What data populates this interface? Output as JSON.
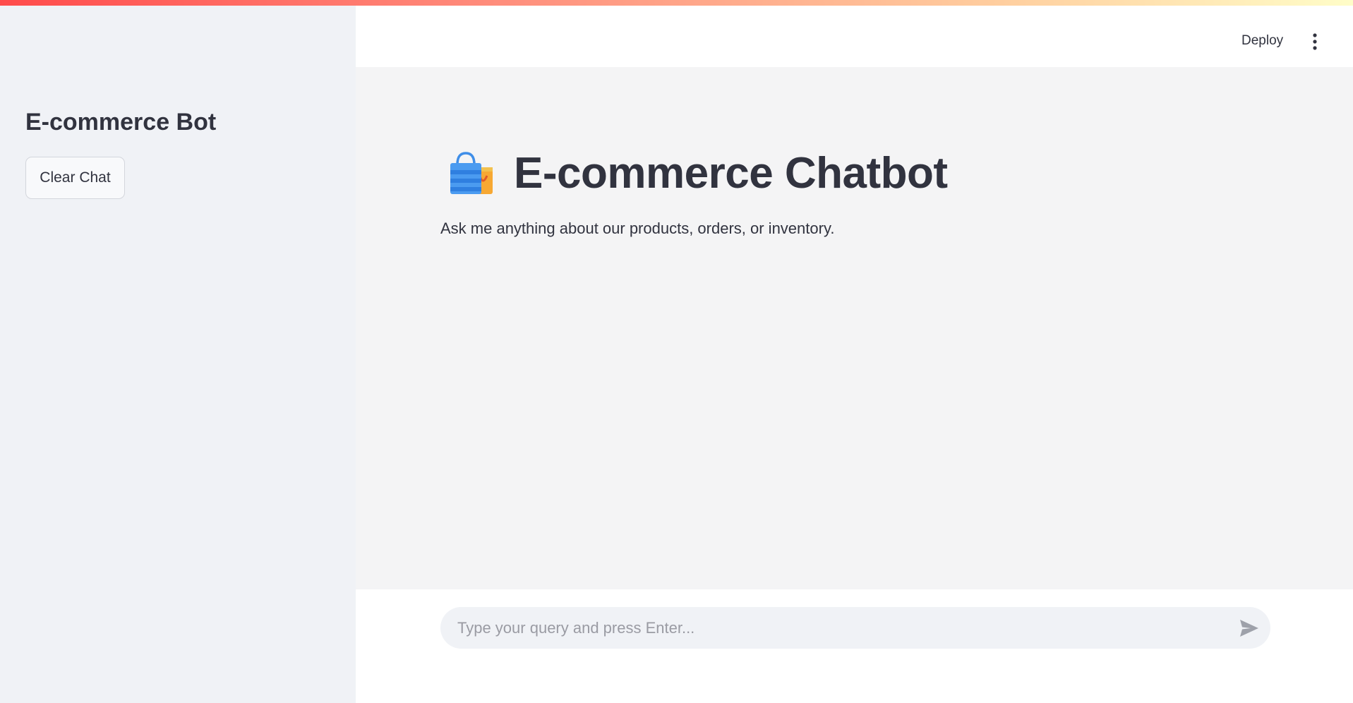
{
  "sidebar": {
    "title": "E-commerce Bot",
    "clear_button_label": "Clear Chat"
  },
  "header": {
    "deploy_label": "Deploy",
    "menu_icon": "more-vertical-icon"
  },
  "main": {
    "title_icon": "shopping-bags-icon",
    "title": "E-commerce Chatbot",
    "subtitle": "Ask me anything about our products, orders, or inventory."
  },
  "chat_input": {
    "placeholder": "Type your query and press Enter...",
    "value": "",
    "send_icon": "send-icon"
  },
  "colors": {
    "sidebar_bg": "#f0f2f6",
    "main_bg": "#f4f4f5",
    "text": "#31333f",
    "accent": "#ff4b4b"
  }
}
